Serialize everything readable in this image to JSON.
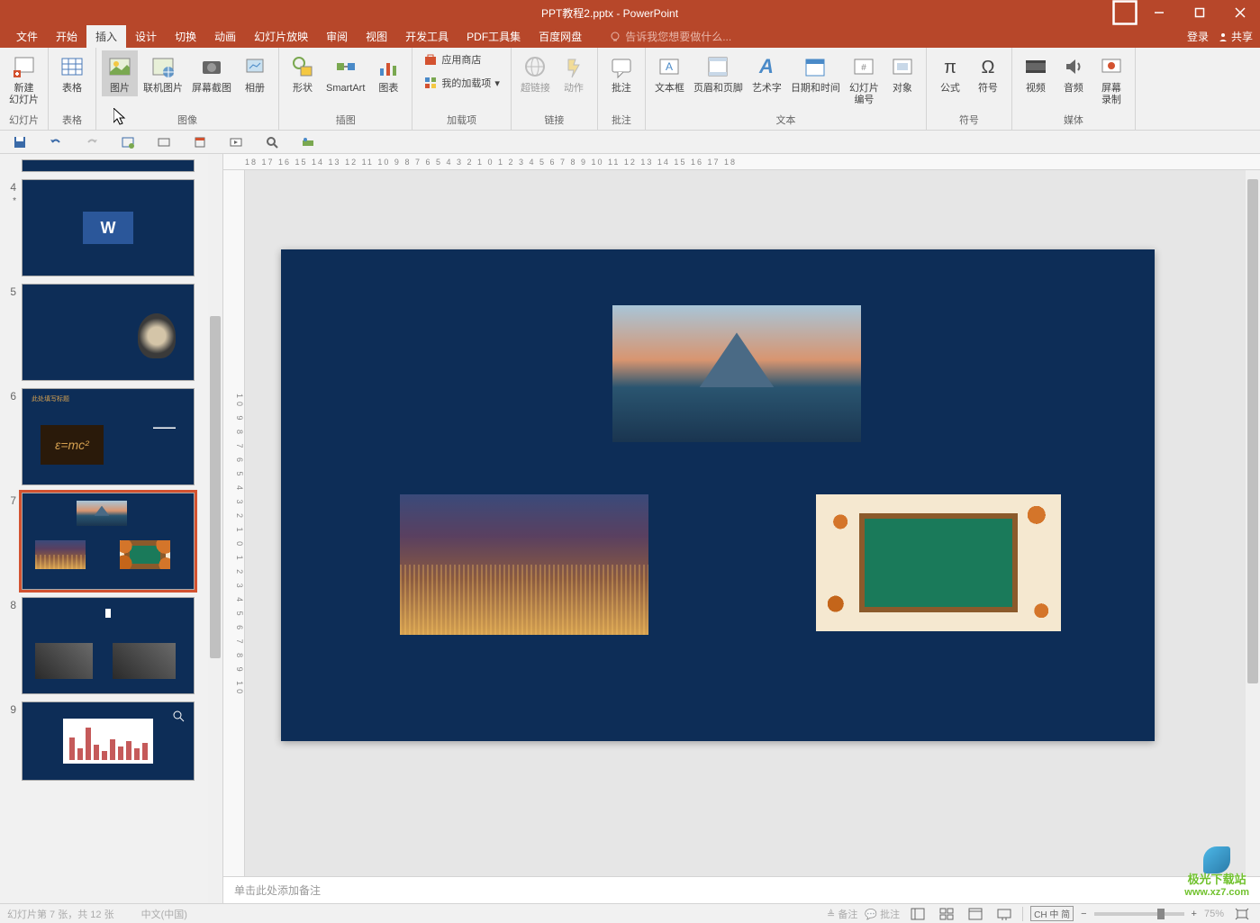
{
  "titlebar": {
    "title": "PPT教程2.pptx - PowerPoint"
  },
  "menu": {
    "file": "文件",
    "home": "开始",
    "insert": "插入",
    "design": "设计",
    "transitions": "切换",
    "animations": "动画",
    "slideshow": "幻灯片放映",
    "review": "审阅",
    "view": "视图",
    "developer": "开发工具",
    "pdf": "PDF工具集",
    "baidu": "百度网盘",
    "tellme_placeholder": "告诉我您想要做什么...",
    "login": "登录",
    "share": "共享"
  },
  "ribbon": {
    "groups": {
      "slides": {
        "label": "幻灯片",
        "new_slide": "新建\n幻灯片"
      },
      "tables": {
        "label": "表格",
        "table": "表格"
      },
      "images": {
        "label": "图像",
        "picture": "图片",
        "online_pic": "联机图片",
        "screenshot": "屏幕截图",
        "album": "相册"
      },
      "illustrations": {
        "label": "插图",
        "shapes": "形状",
        "smartart": "SmartArt",
        "chart": "图表"
      },
      "addins": {
        "label": "加载项",
        "store": "应用商店",
        "myaddins": "我的加载项"
      },
      "links": {
        "label": "链接",
        "hyperlink": "超链接",
        "action": "动作"
      },
      "comments": {
        "label": "批注",
        "comment": "批注"
      },
      "text": {
        "label": "文本",
        "textbox": "文本框",
        "headerfooter": "页眉和页脚",
        "wordart": "艺术字",
        "datetime": "日期和时间",
        "slidenum": "幻灯片\n编号",
        "object": "对象"
      },
      "symbols": {
        "label": "符号",
        "equation": "公式",
        "symbol": "符号"
      },
      "media": {
        "label": "媒体",
        "video": "视频",
        "audio": "音频",
        "screenrec": "屏幕\n录制"
      }
    }
  },
  "thumbnails": {
    "slide4": "4",
    "slide4_star": "*",
    "slide5": "5",
    "slide6": "6",
    "slide6_title": "此处填写标题",
    "slide6_emc": "ε=mc²",
    "slide7": "7",
    "slide8": "8",
    "slide9": "9"
  },
  "ruler": {
    "h": "18   17   16   15   14   13   12   11   10   9   8   7   6   5   4   3   2   1   0   1   2   3   4   5   6   7   8   9   10   11   12   13   14   15   16   17   18",
    "v": "10 9 8 7 6 5 4 3 2 1 0 1 2 3 4 5 6 7 8 9 10"
  },
  "notes": {
    "placeholder": "单击此处添加备注"
  },
  "statusbar": {
    "slide_info": "幻灯片第 7 张，共 12 张",
    "lang": "中文(中国)",
    "notes_btn": "备注",
    "comments_btn": "批注",
    "zoom": "75%",
    "ime": "CH 中 简"
  },
  "watermark": {
    "name": "极光下载站",
    "url": "www.xz7.com"
  }
}
